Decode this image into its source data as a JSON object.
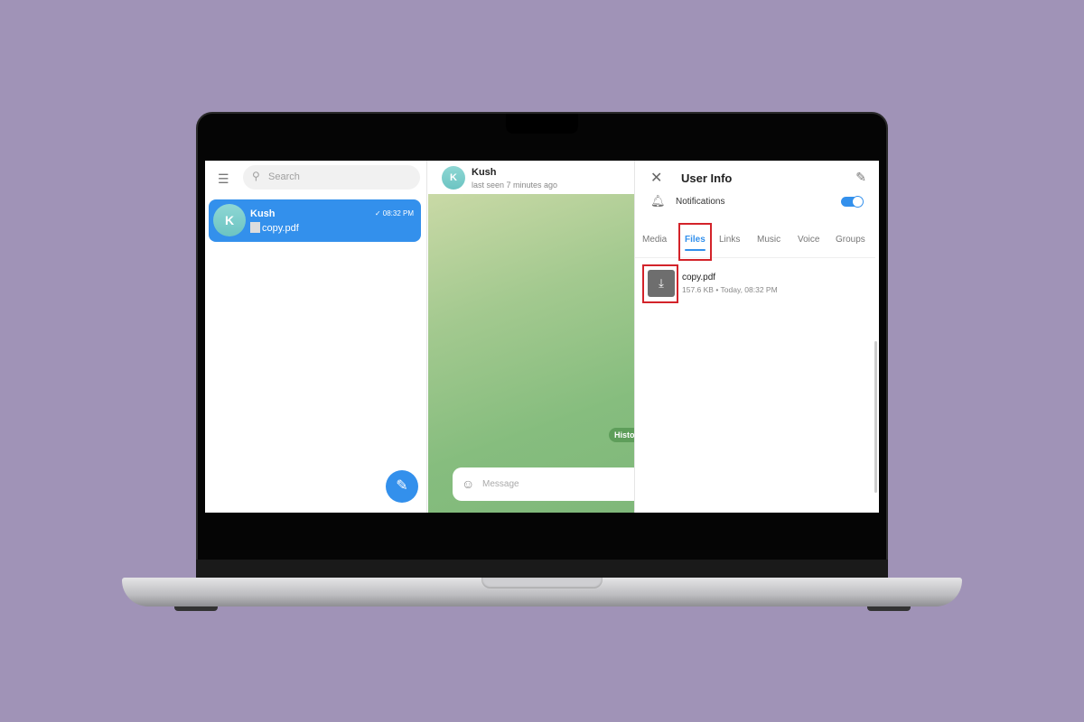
{
  "sidebar": {
    "search_placeholder": "Search",
    "chats": [
      {
        "avatar_letter": "K",
        "name": "Kush",
        "time": "✓ 08:32 PM",
        "last_message": "copy.pdf"
      }
    ]
  },
  "chat": {
    "avatar_letter": "K",
    "name": "Kush",
    "status": "last seen 7 minutes ago",
    "history_badge": "Histo",
    "message_placeholder": "Message"
  },
  "user_info": {
    "title": "User Info",
    "notifications_label": "Notifications",
    "notifications_on": true,
    "tabs": [
      "Media",
      "Files",
      "Links",
      "Music",
      "Voice",
      "Groups"
    ],
    "active_tab": "Files",
    "files": [
      {
        "name": "copy.pdf",
        "meta": "157.6 KB • Today, 08:32 PM"
      }
    ]
  },
  "colors": {
    "accent": "#3390ec",
    "background": "#a093b7",
    "highlight": "#d3232a"
  }
}
